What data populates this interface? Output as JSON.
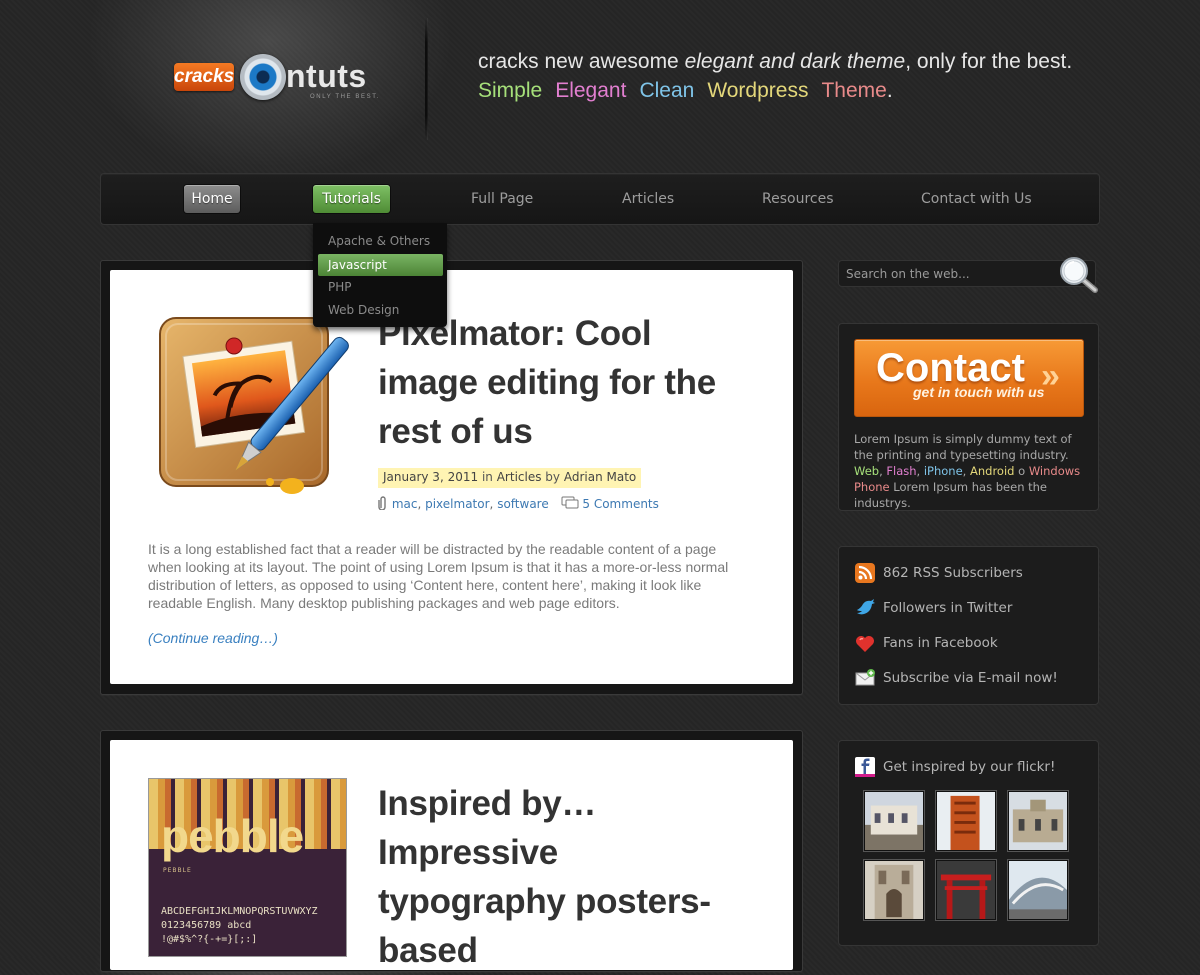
{
  "header": {
    "logo_badge": "cracks",
    "logo_name": "ntuts",
    "logo_tagline": "ONLY THE BEST.",
    "tagline_start": "cracks new awesome ",
    "tagline_em": "elegant and dark theme",
    "tagline_end": ", only for the best.",
    "tag_words": [
      {
        "text": "Simple",
        "color": "#a6e07a"
      },
      {
        "text": "Elegant",
        "color": "#e27fd0"
      },
      {
        "text": "Clean",
        "color": "#7fc4e8"
      },
      {
        "text": "Wordpress",
        "color": "#e3d77a"
      },
      {
        "text": "Theme",
        "color": "#e88a8a"
      }
    ],
    "tag_period": "."
  },
  "nav": {
    "items": [
      {
        "label": "Home"
      },
      {
        "label": "Tutorials"
      },
      {
        "label": "Full Page"
      },
      {
        "label": "Articles"
      },
      {
        "label": "Resources"
      },
      {
        "label": "Contact with Us"
      }
    ],
    "dropdown": [
      "Apache & Others",
      "Javascript",
      "PHP",
      "Web Design"
    ]
  },
  "posts": [
    {
      "title_lines": [
        "Pixelmator: Cool",
        "image editing for the",
        "rest of us"
      ],
      "date": "January 3, 2011",
      "in_label": "in",
      "category": "Articles",
      "by_label": "by",
      "author": "Adrian Mato",
      "tags": [
        "mac",
        "pixelmator",
        "software"
      ],
      "comments": "5 Comments",
      "excerpt": "It is a long established fact that a reader will be distracted by the readable content of a page when looking at its layout. The point of using Lorem Ipsum is that it has a more-or-less normal distribution of letters, as opposed to using ‘Content here, content here’, making it look like readable English. Many desktop publishing packages and web page editors.",
      "more": "(Continue reading…)"
    },
    {
      "title_lines": [
        "Inspired by…",
        "Impressive",
        "typography posters-",
        "based"
      ],
      "poster_word": "pebble",
      "poster_caption": "PEBBLE",
      "poster_line1": "ABCDEFGHIJKLMNOPQRSTUVWXYZ",
      "poster_line2": "0123456789 abcd",
      "poster_line3": "!@#$%^?{-+=}[;:]"
    }
  ],
  "sidebar": {
    "search_placeholder": "Search on the web...",
    "contact_title": "Contact",
    "contact_sub": "get in touch with us",
    "contact_arrow": "»",
    "contact_text_1": "Lorem Ipsum is simply dummy text of the printing and typesetting industry. ",
    "links": [
      {
        "text": "Web",
        "color": "#a6e07a"
      },
      {
        "text": "Flash",
        "color": "#e27fd0"
      },
      {
        "text": "iPhone",
        "color": "#7fc4e8"
      },
      {
        "text": "Android",
        "color": "#e3d77a"
      },
      {
        "text": "Windows Phone",
        "color": "#e88a8a"
      }
    ],
    "contact_text_2": "Lorem Ipsum has been the industrys.",
    "social": [
      {
        "icon": "rss-icon",
        "label": "862 RSS Subscribers"
      },
      {
        "icon": "twitter-bird-icon",
        "label": "Followers in Twitter"
      },
      {
        "icon": "heart-icon",
        "label": "Fans in Facebook"
      },
      {
        "icon": "mail-icon",
        "label": "Subscribe via E-mail now!"
      }
    ],
    "flickr_label": "Get inspired by our flickr!"
  }
}
